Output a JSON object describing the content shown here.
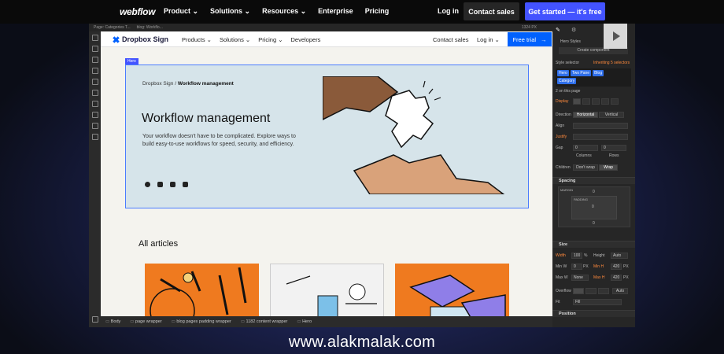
{
  "webflow_nav": {
    "logo": "webflow",
    "items": [
      "Product ⌄",
      "Solutions ⌄",
      "Resources ⌄",
      "Enterprise",
      "Pricing"
    ],
    "login": "Log in",
    "contact_sales": "Contact sales",
    "get_started": "Get started — it's free"
  },
  "designer_top": {
    "text1": "Page: Categories T...",
    "text2": "blog: Workflo...",
    "text3": "1324 PX"
  },
  "site_nav": {
    "logo": "Dropbox Sign",
    "items": [
      "Products ⌄",
      "Solutions ⌄",
      "Pricing ⌄",
      "Developers"
    ],
    "contact_sales": "Contact sales",
    "login": "Log in ⌄",
    "free_trial": "Free trial",
    "free_trial_arrow": "→"
  },
  "hero": {
    "tag": "Hero",
    "breadcrumb_parent": "Dropbox Sign / ",
    "breadcrumb_current": "Workflow management",
    "title": "Workflow management",
    "description": "Your workflow doesn't have to be complicated. Explore ways to build easy-to-use workflows for speed, security, and efficiency.",
    "social_icons": [
      "facebook-icon",
      "twitter-icon",
      "linkedin-icon",
      "rss-icon"
    ]
  },
  "articles": {
    "heading": "All articles"
  },
  "style_panel": {
    "hero_styles": "Hero Styles",
    "create_component": "Create component",
    "style_selector": "Style selector",
    "inheriting": "Inheriting 5 selectors",
    "selectors": [
      "Hero",
      "Two Pane",
      "Blog",
      "Category"
    ],
    "on_this_page": "2 on this page",
    "display_label": "Display",
    "direction_label": "Direction",
    "direction_options": [
      "Horizontal",
      "Vertical"
    ],
    "align_label": "Align",
    "justify_label": "Justify",
    "gap_label": "Gap",
    "gap_columns": "Columns",
    "gap_rows": "Rows",
    "children_label": "Children",
    "children_options": [
      "Don't wrap",
      "Wrap"
    ],
    "spacing_title": "Spacing",
    "margin_label": "MARGIN",
    "padding_label": "PADDING",
    "zero": "0",
    "size_title": "Size",
    "width_label": "Width",
    "width_value": "100",
    "width_unit": "%",
    "height_label": "Height",
    "height_value": "Auto",
    "minw_label": "Min W",
    "minw_value": "0",
    "minw_unit": "PX",
    "minh_label": "Min H",
    "minh_value": "420",
    "minh_unit": "PX",
    "maxw_label": "Max W",
    "maxw_value": "None",
    "maxh_label": "Max H",
    "maxh_value": "420",
    "maxh_unit": "PX",
    "overflow_label": "Overflow",
    "overflow_auto": "Auto",
    "fit_label": "Fit",
    "fit_value": "Fill",
    "position_title": "Position"
  },
  "breadcrumbs": [
    "Body",
    "page wrapper",
    "blog pages padding wrapper",
    "1182 content wrapper",
    "Hero"
  ],
  "footer": "www.alakmalak.com",
  "colors": {
    "accent": "#4353ff",
    "dropbox_blue": "#0061fe",
    "hero_bg": "#d6e4ea",
    "card_orange": "#ef7a1f"
  }
}
